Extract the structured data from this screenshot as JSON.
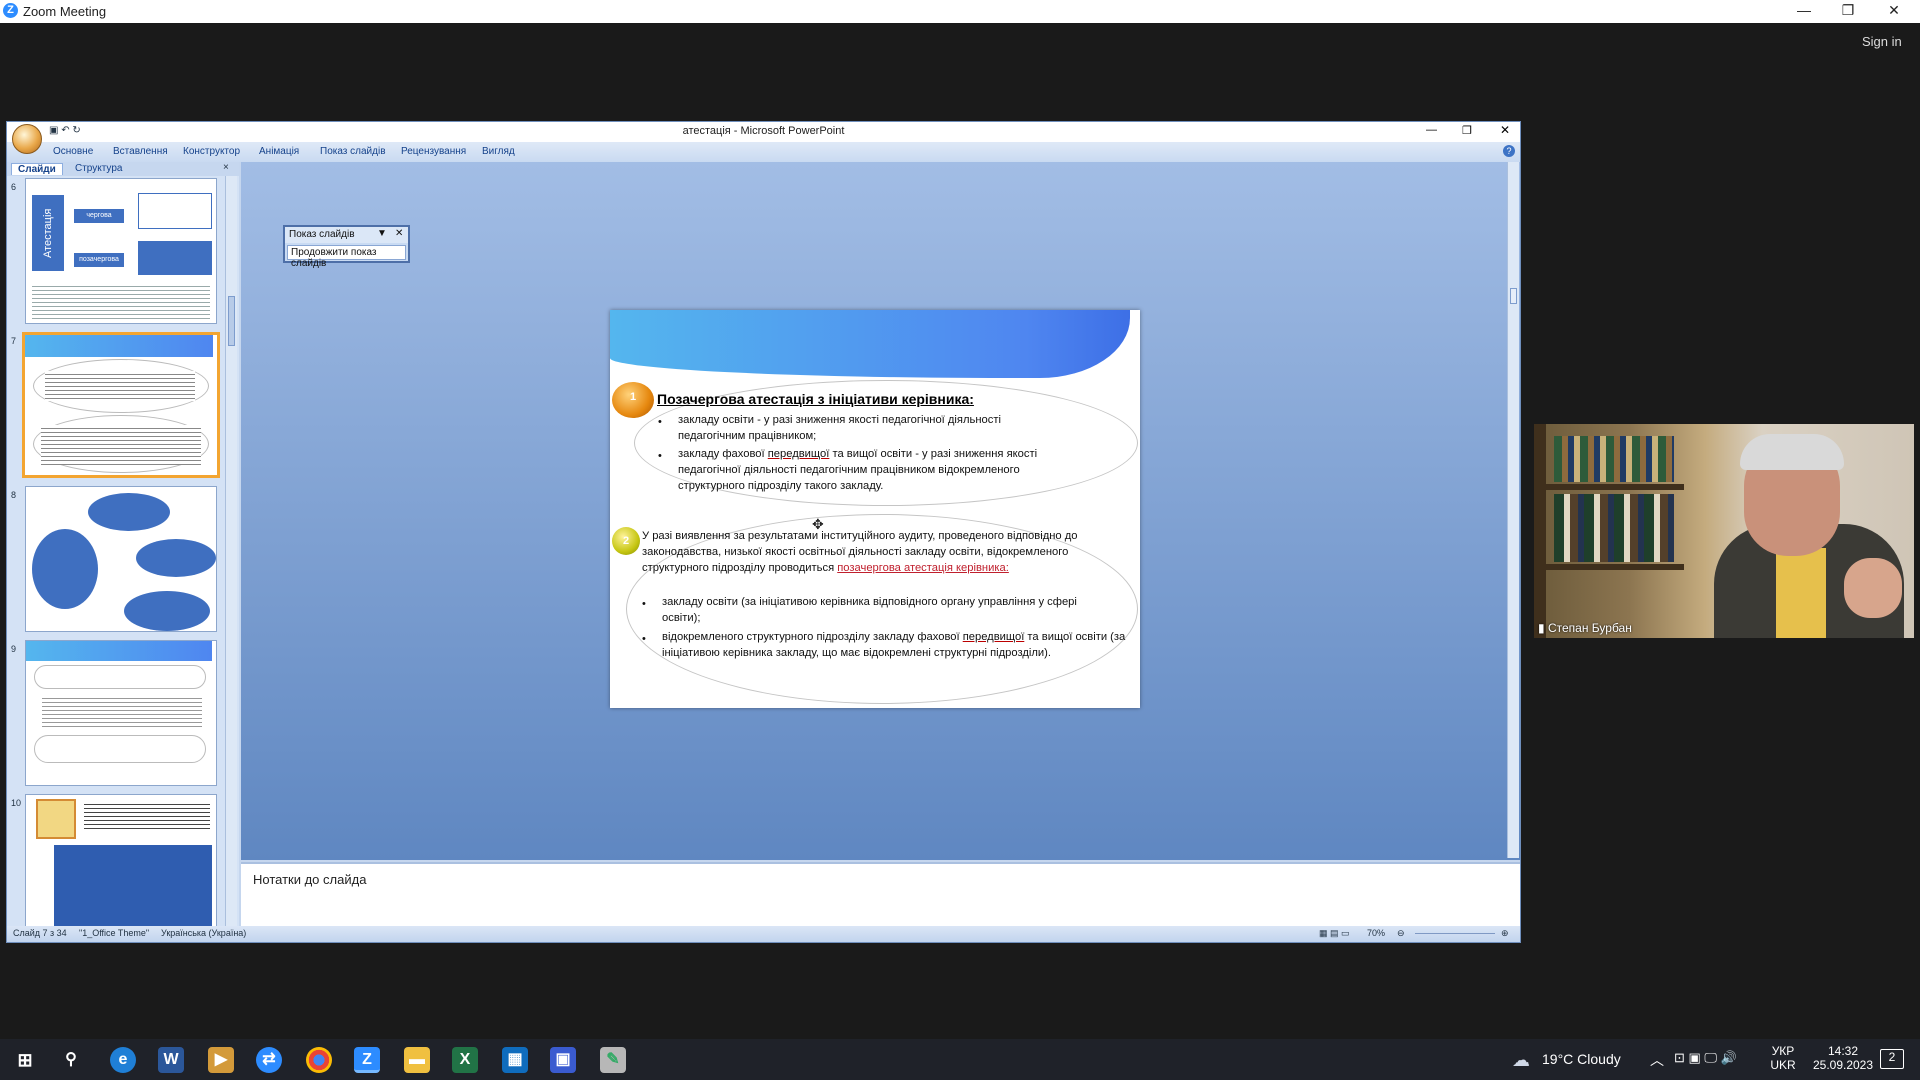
{
  "zoom": {
    "title": "Zoom Meeting",
    "sign_in": "Sign in",
    "controls": {
      "minimize": "—",
      "restore": "❐",
      "close": "✕"
    }
  },
  "ppt": {
    "title": "атестація - Microsoft PowerPoint",
    "tabs": [
      "Основне",
      "Вставлення",
      "Конструктор",
      "Анімація",
      "Показ слайдів",
      "Рецензування",
      "Вигляд"
    ],
    "panel_tabs": [
      "Слайди",
      "Структура"
    ],
    "thumbnail_numbers": [
      "6",
      "7",
      "8",
      "9",
      "10"
    ],
    "notes_placeholder": "Нотатки до слайда",
    "status": {
      "slide": "Слайд 7 з 34",
      "theme": "\"1_Office Theme\"",
      "language": "Українська (Україна)",
      "zoom": "70%"
    },
    "slideshow_toolbar": {
      "header": "Показ слайдів",
      "item": "Продовжити показ слайдів"
    }
  },
  "slide": {
    "marker1": "1",
    "marker2": "2",
    "title": "Позачергова атестація з ініціативи керівника:",
    "block1": [
      "закладу освіти - у разі зниження якості педагогічної діяльності педагогічним працівником;",
      {
        "pre": "закладу фахової ",
        "u": "передвищої",
        "post": " та вищої освіти - у разі зниження якості педагогічної діяльності педагогічним працівником відокремленого структурного підрозділу такого закладу."
      }
    ],
    "block2_intro": "У разі виявлення за результатами інституційного аудиту, проведеного відповідно до законодавства, низької якості освітньої діяльності закладу освіти, відокремленого структурного підрозділу проводиться ",
    "block2_red": "позачергова атестація керівника:",
    "block2_items": [
      "закладу освіти (за ініціативою керівника відповідного органу управління у сфері освіти);",
      {
        "pre": "відокремленого структурного підрозділу закладу фахової ",
        "u": "передвищої",
        "post": " та вищої освіти (за ініціативою керівника закладу, що має відокремлені структурні підрозділи)."
      }
    ]
  },
  "thumbs": {
    "t6_word": "Атестація",
    "t6_box1": "чергова",
    "t6_box2": "позачергова"
  },
  "video": {
    "participant": "Степан Бурбан"
  },
  "taskbar": {
    "weather": "19°C  Cloudy",
    "lang_top": "УКР",
    "lang_bottom": "UKR",
    "time": "14:32",
    "date": "25.09.2023",
    "notifications": "2"
  }
}
